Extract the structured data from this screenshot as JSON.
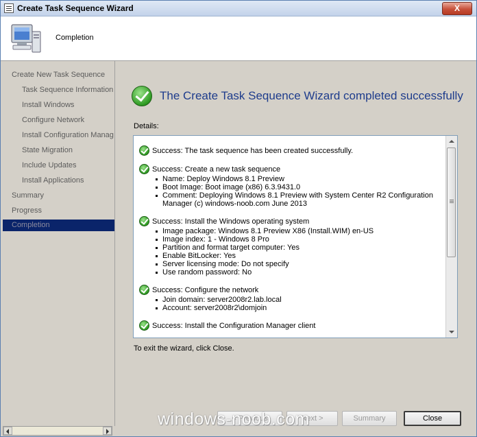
{
  "window": {
    "title": "Create Task Sequence Wizard",
    "close_glyph": "X"
  },
  "header": {
    "heading": "Completion"
  },
  "nav": {
    "items": [
      {
        "label": "Create New Task Sequence",
        "level": "top",
        "state": "normal"
      },
      {
        "label": "Task Sequence Information",
        "level": "sub",
        "state": "normal"
      },
      {
        "label": "Install Windows",
        "level": "sub",
        "state": "normal"
      },
      {
        "label": "Configure Network",
        "level": "sub",
        "state": "normal"
      },
      {
        "label": "Install Configuration Manag",
        "level": "sub",
        "state": "normal"
      },
      {
        "label": "State Migration",
        "level": "sub",
        "state": "normal"
      },
      {
        "label": "Include Updates",
        "level": "sub",
        "state": "normal"
      },
      {
        "label": "Install Applications",
        "level": "sub",
        "state": "normal"
      },
      {
        "label": "Summary",
        "level": "top",
        "state": "normal"
      },
      {
        "label": "Progress",
        "level": "top",
        "state": "normal"
      },
      {
        "label": "Completion",
        "level": "top",
        "state": "active"
      }
    ]
  },
  "main": {
    "title": "The Create Task Sequence Wizard completed successfully",
    "details_label": "Details:",
    "details": [
      {
        "heading": "Success: The task sequence has been created successfully.",
        "bullets": []
      },
      {
        "heading": "Success: Create a new task sequence",
        "bullets": [
          "Name: Deploy Windows 8.1 Preview",
          "Boot Image: Boot image (x86) 6.3.9431.0",
          "Comment: Deploying Windows 8.1 Preview with System Center R2 Configuration Manager (c) windows-noob.com June 2013"
        ]
      },
      {
        "heading": "Success: Install the Windows operating system",
        "bullets": [
          "Image package: Windows 8.1 Preview X86 (Install.WIM) en-US",
          "Image index: 1 - Windows 8 Pro",
          "Partition and format target computer: Yes",
          "Enable BitLocker: Yes",
          "Server licensing mode: Do not specify",
          "Use random password: No"
        ]
      },
      {
        "heading": "Success: Configure the network",
        "bullets": [
          "Join domain: server2008r2.lab.local",
          "Account: server2008r2\\domjoin"
        ]
      },
      {
        "heading": "Success: Install the Configuration Manager client",
        "bullets": []
      }
    ],
    "exit_text": "To exit the wizard, click Close."
  },
  "buttons": {
    "previous": "< Previous",
    "next": "Next >",
    "summary": "Summary",
    "close": "Close"
  },
  "watermark": "windows-noob.com"
}
